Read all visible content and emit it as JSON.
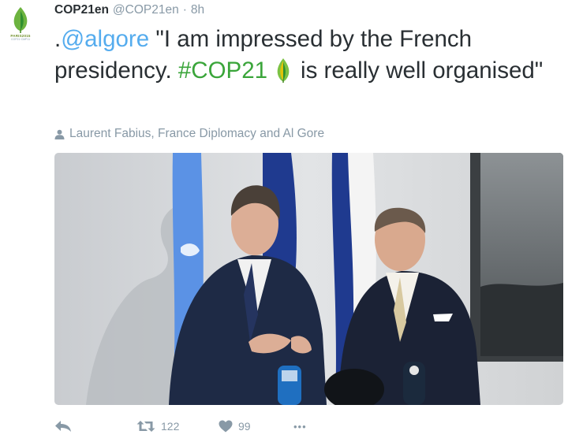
{
  "account": {
    "name": "COP21en",
    "handle": "@COP21en",
    "separator": "·",
    "time": "8h",
    "avatar_brand_top": "PARIS2015",
    "avatar_brand_bottom": "COP21·CMP11"
  },
  "tweet": {
    "prefix": ".",
    "mention": "@algore",
    "text_1": " \"I am impressed by the French presidency. ",
    "hashtag": "#COP21",
    "text_2": "is really well organised\""
  },
  "tagged": {
    "label": "Laurent Fabius, France Diplomacy and Al Gore"
  },
  "actions": {
    "retweet_count": "122",
    "like_count": "99",
    "more_label": "•••"
  },
  "colors": {
    "link": "#55acee",
    "hashtag": "#3aa53a",
    "muted": "#8899a6",
    "text": "#292f33"
  },
  "icons": [
    "cop21-leaf-icon",
    "person-icon",
    "reply-icon",
    "retweet-icon",
    "heart-icon",
    "more-icon"
  ]
}
